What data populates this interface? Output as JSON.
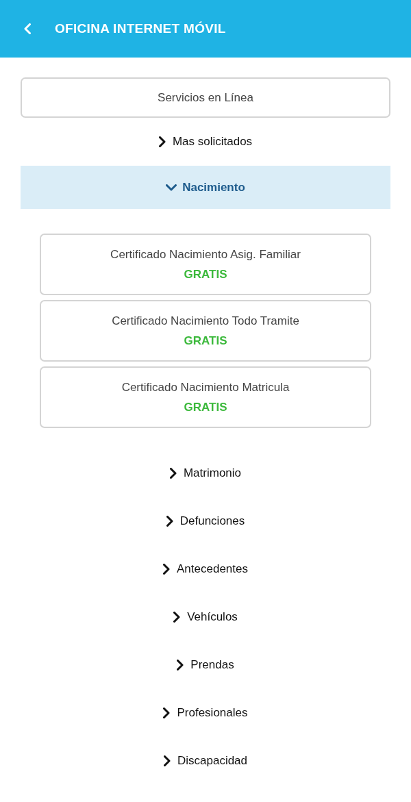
{
  "header": {
    "title": "OFICINA INTERNET MÓVIL"
  },
  "services_button": {
    "label": "Servicios en Línea"
  },
  "categories": [
    {
      "label": "Mas solicitados",
      "expanded": false
    },
    {
      "label": "Nacimiento",
      "expanded": true,
      "children": [
        {
          "title": "Certificado Nacimiento Asig. Familiar",
          "price": "GRATIS"
        },
        {
          "title": "Certificado Nacimiento Todo Tramite",
          "price": "GRATIS"
        },
        {
          "title": "Certificado Nacimiento Matricula",
          "price": "GRATIS"
        }
      ]
    },
    {
      "label": "Matrimonio",
      "expanded": false
    },
    {
      "label": "Defunciones",
      "expanded": false
    },
    {
      "label": "Antecedentes",
      "expanded": false
    },
    {
      "label": "Vehículos",
      "expanded": false
    },
    {
      "label": "Prendas",
      "expanded": false
    },
    {
      "label": "Profesionales",
      "expanded": false
    },
    {
      "label": "Discapacidad",
      "expanded": false
    }
  ]
}
